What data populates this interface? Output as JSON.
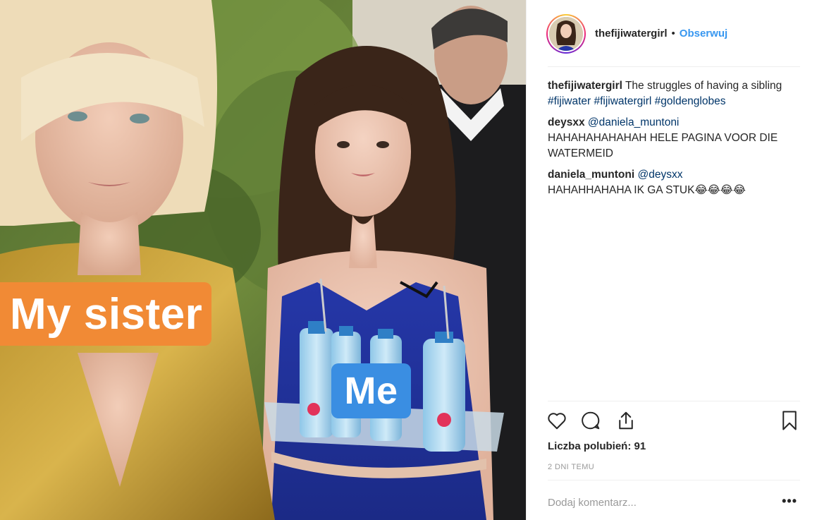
{
  "post": {
    "labels": {
      "sister": "My sister",
      "me": "Me"
    },
    "bottle_brand": "FIJI"
  },
  "header": {
    "username": "thefijiwatergirl",
    "separator": "•",
    "follow_label": "Obserwuj"
  },
  "caption": {
    "user": "thefijiwatergirl",
    "text": "The struggles of having a sibling",
    "hashtags": [
      "#fijiwater",
      "#fijiwatergirl",
      "#goldenglobes"
    ]
  },
  "comments": [
    {
      "user": "deysxx",
      "mention": "@daniela_muntoni",
      "text": "HAHAHAHAHAHAH HELE PAGINA VOOR DIE WATERMEID"
    },
    {
      "user": "daniela_muntoni",
      "mention": "@deysxx",
      "text": "HAHAHHAHAHA IK GA STUK😂😂😂😂"
    }
  ],
  "actions": {
    "icons": [
      "heart-icon",
      "comment-icon",
      "share-icon",
      "bookmark-icon"
    ]
  },
  "likes": "Liczba polubień: 91",
  "date": "2 DNI TEMU",
  "add_comment": {
    "placeholder": "Dodaj komentarz..."
  },
  "more": "•••",
  "colors": {
    "link": "#3897f0",
    "hashtag": "#003569",
    "sister_label": "#f18a35",
    "me_label": "#3a8ee2"
  }
}
